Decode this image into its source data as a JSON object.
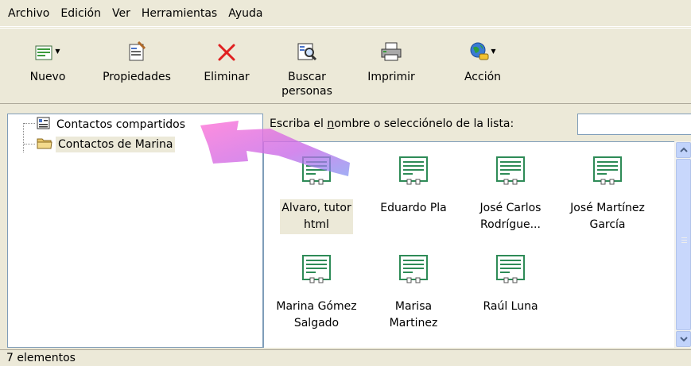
{
  "menu": [
    "Archivo",
    "Edición",
    "Ver",
    "Herramientas",
    "Ayuda"
  ],
  "toolbar": {
    "new": "Nuevo",
    "properties": "Propiedades",
    "delete": "Eliminar",
    "find_line1": "Buscar",
    "find_line2": "personas",
    "print": "Imprimir",
    "action": "Acción"
  },
  "tree": {
    "shared": "Contactos compartidos",
    "marina": "Contactos de Marina"
  },
  "search": {
    "prompt_pre": "Escriba el ",
    "prompt_u": "n",
    "prompt_post": "ombre o selecciónelo de la lista:",
    "value": ""
  },
  "contacts": [
    {
      "l1": "Alvaro, tutor",
      "l2": "html"
    },
    {
      "l1": "Eduardo Pla",
      "l2": ""
    },
    {
      "l1": "José Carlos",
      "l2": "Rodrígue..."
    },
    {
      "l1": "José Martínez",
      "l2": "García"
    },
    {
      "l1": "Marina Gómez",
      "l2": "Salgado"
    },
    {
      "l1": "Marisa",
      "l2": "Martinez"
    },
    {
      "l1": "Raúl Luna",
      "l2": ""
    }
  ],
  "status": "7 elementos",
  "colors": {
    "window_bg": "#ece9d8",
    "selection": "#ece9d8",
    "border": "#7f9db9",
    "contact_icon": "#2e8b57",
    "arrow": "#d86fe0"
  }
}
